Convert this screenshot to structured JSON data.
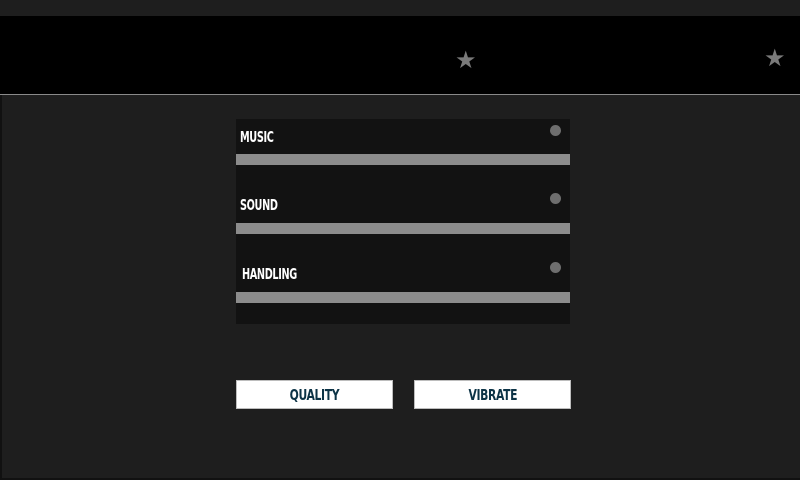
{
  "header": {
    "star_icons": [
      "star-icon",
      "star-icon"
    ]
  },
  "settings": [
    {
      "label": "MUSIC",
      "level": 0.95
    },
    {
      "label": "SOUND",
      "level": 0.95
    },
    {
      "label": "HANDLING",
      "level": 0.95
    }
  ],
  "buttons": {
    "quality_label": "QUALITY",
    "vibrate_label": "VIBRATE"
  },
  "colors": {
    "background": "#1e1e1e",
    "header": "#000000",
    "panel": "#121212",
    "track": "#8c8c8c",
    "knob": "#6e6e6e",
    "button_bg": "#ffffff",
    "button_text": "#0c3346"
  }
}
